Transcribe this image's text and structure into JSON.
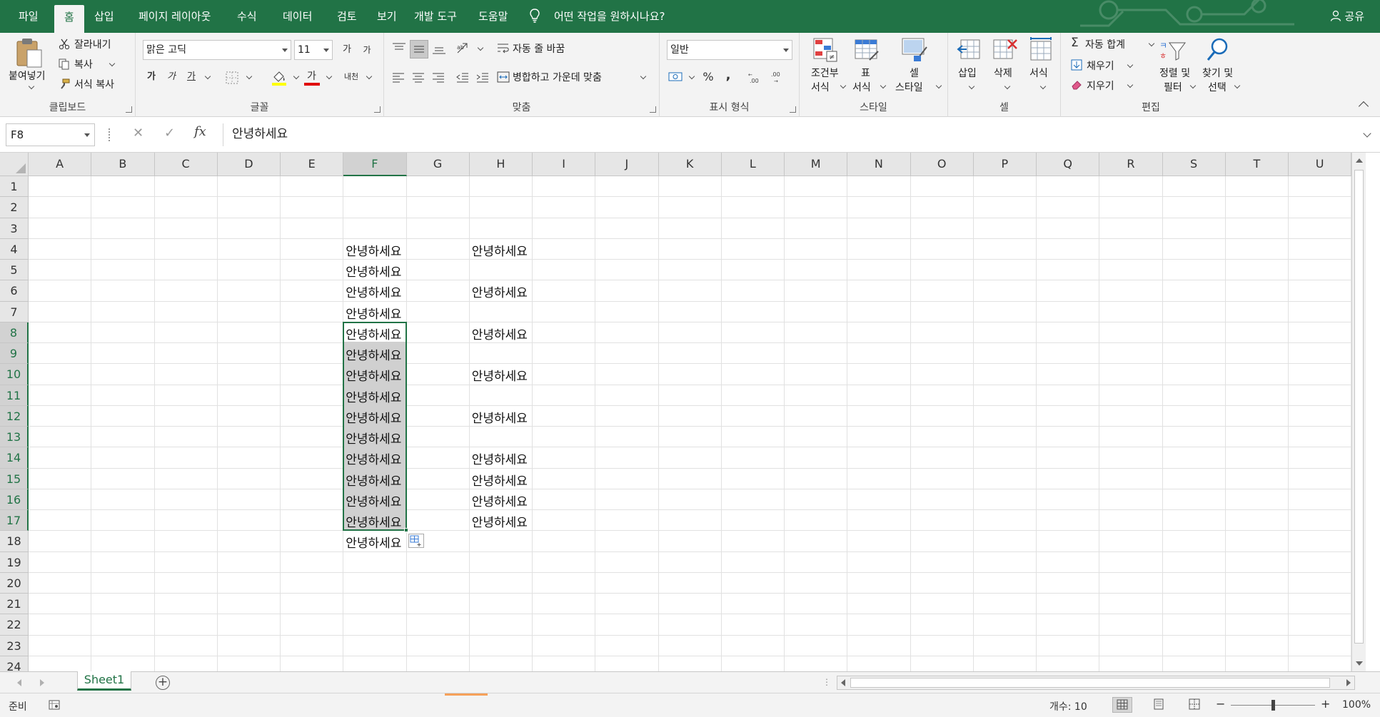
{
  "menu": {
    "tabs": [
      "파일",
      "홈",
      "삽입",
      "페이지 레이아웃",
      "수식",
      "데이터",
      "검토",
      "보기",
      "개발 도구",
      "도움말"
    ],
    "active_tab": "홈",
    "tell_me": "어떤 작업을 원하시나요?",
    "share": "공유"
  },
  "ribbon": {
    "clipboard": {
      "label": "클립보드",
      "paste": "붙여넣기",
      "cut": "잘라내기",
      "copy": "복사",
      "format_painter": "서식 복사"
    },
    "font": {
      "label": "글꼴",
      "font_name": "맑은 고딕",
      "font_size": "11",
      "grow": "가",
      "shrink": "가",
      "bold": "가",
      "italic": "가",
      "underline": "가",
      "font_color_glyph": "가",
      "phonetic": "내천"
    },
    "alignment": {
      "label": "맞춤",
      "wrap": "자동 줄 바꿈",
      "merge": "병합하고 가운데 맞춤"
    },
    "number": {
      "label": "표시 형식",
      "format": "일반",
      "percent": "%",
      "comma": ","
    },
    "styles": {
      "label": "스타일",
      "conditional_1": "조건부",
      "conditional_2": "서식",
      "table_1": "표",
      "table_2": "서식",
      "cell_1": "셀",
      "cell_2": "스타일"
    },
    "cells": {
      "label": "셀",
      "insert": "삽입",
      "delete": "삭제",
      "format": "서식"
    },
    "editing": {
      "label": "편집",
      "autosum": "자동 합계",
      "fill": "채우기",
      "clear": "지우기",
      "sort_1": "정렬 및",
      "sort_2": "필터",
      "find_1": "찾기 및",
      "find_2": "선택"
    }
  },
  "formula_bar": {
    "name_box": "F8",
    "fx": "fx",
    "value": "안녕하세요"
  },
  "grid": {
    "columns": [
      "A",
      "B",
      "C",
      "D",
      "E",
      "F",
      "G",
      "H",
      "I",
      "J",
      "K",
      "L",
      "M",
      "N",
      "O",
      "P",
      "Q",
      "R",
      "S",
      "T",
      "U"
    ],
    "rows": [
      "1",
      "2",
      "3",
      "4",
      "5",
      "6",
      "7",
      "8",
      "9",
      "10",
      "11",
      "12",
      "13",
      "14",
      "15",
      "16",
      "17",
      "18",
      "19",
      "20",
      "21",
      "22",
      "23",
      "24"
    ],
    "selected_column": "F",
    "selected_range": "F8:F17",
    "cells": {
      "F4": "안녕하세요",
      "H4": "안녕하세요",
      "F5": "안녕하세요",
      "F6": "안녕하세요",
      "H6": "안녕하세요",
      "F7": "안녕하세요",
      "F8": "안녕하세요",
      "H8": "안녕하세요",
      "F9": "안녕하세요",
      "F10": "안녕하세요",
      "H10": "안녕하세요",
      "F11": "안녕하세요",
      "F12": "안녕하세요",
      "H12": "안녕하세요",
      "F13": "안녕하세요",
      "F14": "안녕하세요",
      "H14": "안녕하세요",
      "F15": "안녕하세요",
      "H15": "안녕하세요",
      "F16": "안녕하세요",
      "H16": "안녕하세요",
      "F17": "안녕하세요",
      "H17": "안녕하세요",
      "F18": "안녕하세요"
    }
  },
  "sheets": {
    "tabs": [
      "Sheet1"
    ],
    "active": "Sheet1"
  },
  "status": {
    "mode": "준비",
    "count": "개수: 10",
    "zoom": "100%",
    "zoom_minus": "−",
    "zoom_plus": "+"
  },
  "colors": {
    "accent": "#217346",
    "selection_fill": "#d0d0d0",
    "header_bg": "#e6e6e6"
  },
  "icons": [
    "lightbulb-icon",
    "user-icon",
    "paste-icon",
    "scissors-icon",
    "copy-icon",
    "paintbrush-icon",
    "borders-icon",
    "fill-color-icon",
    "font-color-icon",
    "orientation-icon",
    "wrap-text-icon",
    "merge-icon",
    "currency-icon",
    "conditional-format-icon",
    "format-table-icon",
    "cell-styles-icon",
    "insert-cells-icon",
    "delete-cells-icon",
    "format-cells-icon",
    "sigma-icon",
    "fill-down-icon",
    "eraser-icon",
    "sort-filter-icon",
    "magnifier-icon",
    "cancel-icon",
    "enter-icon",
    "autofill-options-icon",
    "plus-icon",
    "normal-view-icon",
    "page-layout-icon",
    "page-break-icon",
    "macro-record-icon"
  ]
}
